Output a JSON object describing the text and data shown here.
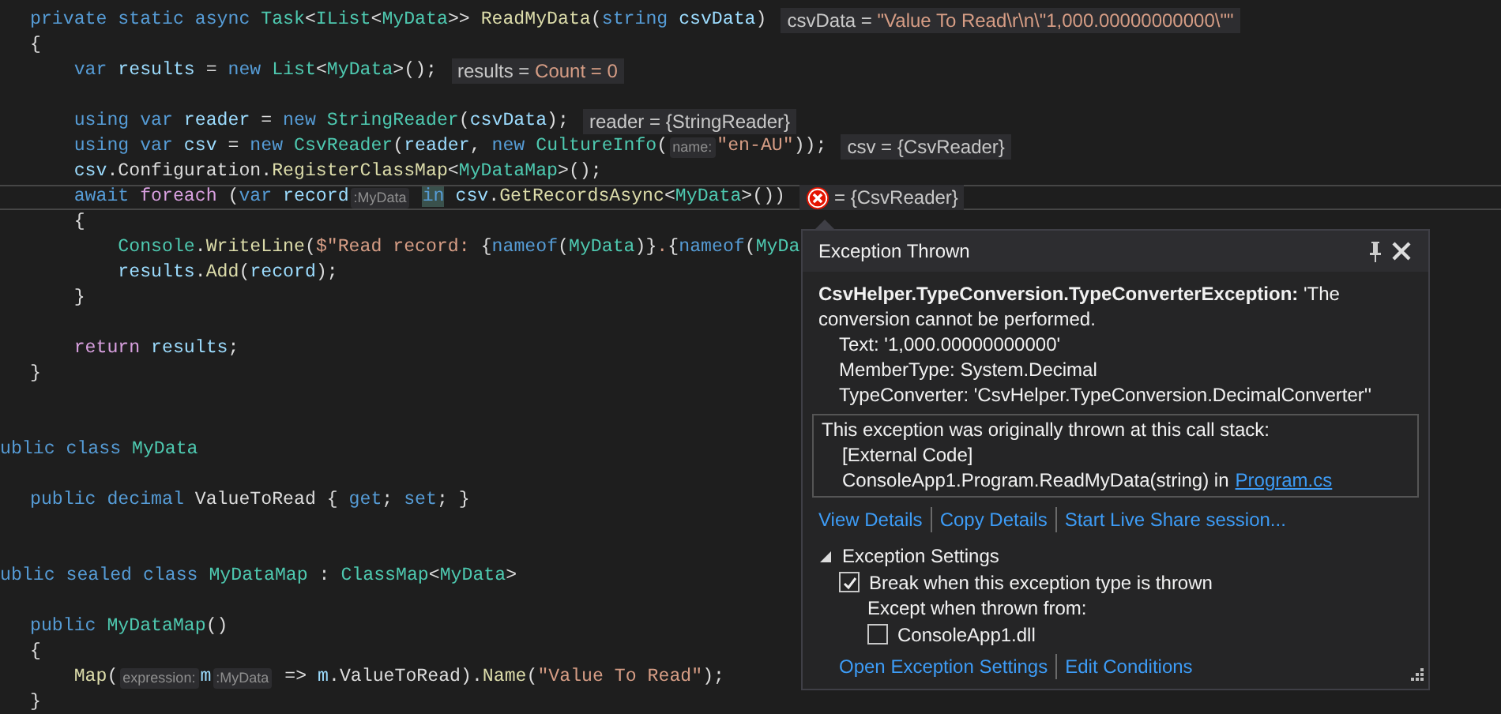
{
  "editor": {
    "lines": [
      {
        "kind": "code",
        "tokens": [
          {
            "kind": "kw",
            "text": "private static async "
          },
          {
            "kind": "type",
            "text": "Task"
          },
          {
            "kind": "plain",
            "text": "<"
          },
          {
            "kind": "type",
            "text": "IList"
          },
          {
            "kind": "plain",
            "text": "<"
          },
          {
            "kind": "type",
            "text": "MyData"
          },
          {
            "kind": "plain",
            "text": ">> "
          },
          {
            "kind": "method",
            "text": "ReadMyData"
          },
          {
            "kind": "plain",
            "text": "("
          },
          {
            "kind": "kw",
            "text": "string "
          },
          {
            "kind": "var",
            "text": "csvData"
          },
          {
            "kind": "plain",
            "text": ")"
          },
          {
            "kind": "datatip",
            "label": "csvData =",
            "value": "\"Value To Read\\r\\n\\\"1,000.00000000000\\\"\"",
            "value_highlighted": true
          }
        ]
      },
      {
        "kind": "code",
        "tokens": [
          {
            "kind": "plain",
            "text": "{"
          }
        ]
      },
      {
        "kind": "code",
        "tokens": [
          {
            "kind": "kw",
            "text": "    var "
          },
          {
            "kind": "var",
            "text": "results"
          },
          {
            "kind": "plain",
            "text": " = "
          },
          {
            "kind": "kw",
            "text": "new "
          },
          {
            "kind": "type",
            "text": "List"
          },
          {
            "kind": "plain",
            "text": "<"
          },
          {
            "kind": "type",
            "text": "MyData"
          },
          {
            "kind": "plain",
            "text": ">();"
          },
          {
            "kind": "datatip",
            "label": "results =",
            "value": "Count = 0",
            "value_highlighted": true
          }
        ]
      },
      {
        "kind": "blank"
      },
      {
        "kind": "code",
        "tokens": [
          {
            "kind": "kw",
            "text": "    using var "
          },
          {
            "kind": "var",
            "text": "reader"
          },
          {
            "kind": "plain",
            "text": " = "
          },
          {
            "kind": "kw",
            "text": "new "
          },
          {
            "kind": "type",
            "text": "StringReader"
          },
          {
            "kind": "plain",
            "text": "("
          },
          {
            "kind": "var",
            "text": "csvData"
          },
          {
            "kind": "plain",
            "text": ");"
          },
          {
            "kind": "datatip",
            "label": "reader =",
            "value": "{StringReader}",
            "value_highlighted": false
          }
        ]
      },
      {
        "kind": "code",
        "tokens": [
          {
            "kind": "kw",
            "text": "    using var "
          },
          {
            "kind": "var",
            "text": "csv"
          },
          {
            "kind": "plain",
            "text": " = "
          },
          {
            "kind": "kw",
            "text": "new "
          },
          {
            "kind": "type",
            "text": "CsvReader"
          },
          {
            "kind": "plain",
            "text": "("
          },
          {
            "kind": "var",
            "text": "reader"
          },
          {
            "kind": "plain",
            "text": ", "
          },
          {
            "kind": "kw",
            "text": "new "
          },
          {
            "kind": "type",
            "text": "CultureInfo"
          },
          {
            "kind": "plain",
            "text": "("
          },
          {
            "kind": "param",
            "text": "name:"
          },
          {
            "kind": "str",
            "text": "\"en-AU\""
          },
          {
            "kind": "plain",
            "text": "));"
          },
          {
            "kind": "datatip",
            "label": "csv =",
            "value": "{CsvReader}",
            "value_highlighted": false
          }
        ]
      },
      {
        "kind": "code",
        "tokens": [
          {
            "kind": "var",
            "text": "    csv"
          },
          {
            "kind": "plain",
            "text": ".Configuration."
          },
          {
            "kind": "method",
            "text": "RegisterClassMap"
          },
          {
            "kind": "plain",
            "text": "<"
          },
          {
            "kind": "type",
            "text": "MyDataMap"
          },
          {
            "kind": "plain",
            "text": ">();"
          }
        ]
      },
      {
        "kind": "current",
        "tokens": [
          {
            "kind": "kw",
            "text": "    await "
          },
          {
            "kind": "ctl",
            "text": "foreach"
          },
          {
            "kind": "plain",
            "text": " ("
          },
          {
            "kind": "kw",
            "text": "var "
          },
          {
            "kind": "var",
            "text": "record"
          },
          {
            "kind": "typehint",
            "text": ":MyData"
          },
          {
            "kind": "kw-hl",
            "text": "in"
          },
          {
            "kind": "var",
            "text": "csv"
          },
          {
            "kind": "plain",
            "text": "."
          },
          {
            "kind": "method",
            "text": "GetRecordsAsync"
          },
          {
            "kind": "plain",
            "text": "<"
          },
          {
            "kind": "type",
            "text": "MyData"
          },
          {
            "kind": "plain",
            "text": ">())"
          },
          {
            "kind": "datatip",
            "error": true,
            "label": "=",
            "value": "{CsvReader}",
            "value_highlighted": false
          }
        ]
      },
      {
        "kind": "code",
        "tokens": [
          {
            "kind": "plain",
            "text": "    {"
          }
        ]
      },
      {
        "kind": "code",
        "tokens": [
          {
            "kind": "type",
            "text": "        Console"
          },
          {
            "kind": "plain",
            "text": "."
          },
          {
            "kind": "method",
            "text": "WriteLine"
          },
          {
            "kind": "plain",
            "text": "("
          },
          {
            "kind": "str",
            "text": "$\"Read record: "
          },
          {
            "kind": "plain",
            "text": "{"
          },
          {
            "kind": "kw",
            "text": "nameof"
          },
          {
            "kind": "plain",
            "text": "("
          },
          {
            "kind": "type",
            "text": "MyData"
          },
          {
            "kind": "plain",
            "text": ")}"
          },
          {
            "kind": "str",
            "text": "."
          },
          {
            "kind": "plain",
            "text": "{"
          },
          {
            "kind": "kw",
            "text": "nameof"
          },
          {
            "kind": "plain",
            "text": "("
          },
          {
            "kind": "type",
            "text": "MyDa"
          }
        ]
      },
      {
        "kind": "code",
        "tokens": [
          {
            "kind": "var",
            "text": "        results"
          },
          {
            "kind": "plain",
            "text": "."
          },
          {
            "kind": "method",
            "text": "Add"
          },
          {
            "kind": "plain",
            "text": "("
          },
          {
            "kind": "var",
            "text": "record"
          },
          {
            "kind": "plain",
            "text": ");"
          }
        ]
      },
      {
        "kind": "code",
        "tokens": [
          {
            "kind": "plain",
            "text": "    }"
          }
        ]
      },
      {
        "kind": "blank"
      },
      {
        "kind": "code",
        "tokens": [
          {
            "kind": "ctl",
            "text": "    return "
          },
          {
            "kind": "var",
            "text": "results"
          },
          {
            "kind": "plain",
            "text": ";"
          }
        ]
      },
      {
        "kind": "code",
        "tokens": [
          {
            "kind": "plain",
            "text": "}"
          }
        ]
      },
      {
        "kind": "blank"
      },
      {
        "kind": "blank"
      },
      {
        "kind": "clipped",
        "tokens": [
          {
            "kind": "kw",
            "text": "ublic class "
          },
          {
            "kind": "type",
            "text": "MyData"
          }
        ]
      },
      {
        "kind": "blank"
      },
      {
        "kind": "code",
        "tokens": [
          {
            "kind": "kw",
            "text": "public decimal "
          },
          {
            "kind": "plain",
            "text": "ValueToRead { "
          },
          {
            "kind": "kw",
            "text": "get"
          },
          {
            "kind": "plain",
            "text": "; "
          },
          {
            "kind": "kw",
            "text": "set"
          },
          {
            "kind": "plain",
            "text": "; }"
          }
        ]
      },
      {
        "kind": "blank"
      },
      {
        "kind": "blank"
      },
      {
        "kind": "clipped",
        "tokens": [
          {
            "kind": "kw",
            "text": "ublic sealed class "
          },
          {
            "kind": "type",
            "text": "MyDataMap"
          },
          {
            "kind": "plain",
            "text": " : "
          },
          {
            "kind": "type",
            "text": "ClassMap"
          },
          {
            "kind": "plain",
            "text": "<"
          },
          {
            "kind": "type",
            "text": "MyData"
          },
          {
            "kind": "plain",
            "text": ">"
          }
        ]
      },
      {
        "kind": "blank"
      },
      {
        "kind": "code",
        "tokens": [
          {
            "kind": "kw",
            "text": "public "
          },
          {
            "kind": "type",
            "text": "MyDataMap"
          },
          {
            "kind": "plain",
            "text": "()"
          }
        ]
      },
      {
        "kind": "code",
        "tokens": [
          {
            "kind": "plain",
            "text": "{"
          }
        ]
      },
      {
        "kind": "code",
        "tokens": [
          {
            "kind": "method",
            "text": "    Map"
          },
          {
            "kind": "plain",
            "text": "("
          },
          {
            "kind": "param",
            "text": "expression:"
          },
          {
            "kind": "var",
            "text": "m"
          },
          {
            "kind": "typehint",
            "text": ":MyData"
          },
          {
            "kind": "plain",
            "text": " => "
          },
          {
            "kind": "var",
            "text": "m"
          },
          {
            "kind": "plain",
            "text": ".ValueToRead)."
          },
          {
            "kind": "method",
            "text": "Name"
          },
          {
            "kind": "plain",
            "text": "("
          },
          {
            "kind": "str",
            "text": "\"Value To Read\""
          },
          {
            "kind": "plain",
            "text": ");"
          }
        ]
      },
      {
        "kind": "code",
        "tokens": [
          {
            "kind": "plain",
            "text": "}"
          }
        ]
      }
    ]
  },
  "exception_popup": {
    "title": "Exception Thrown",
    "message": "**CsvHelper.TypeConversion.TypeConverterException:** 'The conversion cannot be performed.",
    "details": [
      "Text: '1,000.00000000000'",
      "MemberType: System.Decimal",
      "TypeConverter: 'CsvHelper.TypeConversion.DecimalConverter''"
    ],
    "call_stack": {
      "heading": "This exception was originally thrown at this call stack:",
      "frames": [
        {
          "text": "[External Code]"
        },
        {
          "text": "ConsoleApp1.Program.ReadMyData(string) in",
          "link": "Program.cs"
        }
      ]
    },
    "actions": [
      "View Details",
      "Copy Details",
      "Start Live Share session..."
    ],
    "settings": {
      "label": "Exception Settings",
      "expanded": true,
      "items": [
        {
          "kind": "checkbox",
          "label": "Break when this exception type is thrown",
          "checked": true
        },
        {
          "kind": "label",
          "label": "Except when thrown from:",
          "children": [
            {
              "kind": "checkbox",
              "label": "ConsoleApp1.dll",
              "checked": false
            }
          ]
        }
      ]
    },
    "settings_links": [
      "Open Exception Settings",
      "Edit Conditions"
    ]
  }
}
